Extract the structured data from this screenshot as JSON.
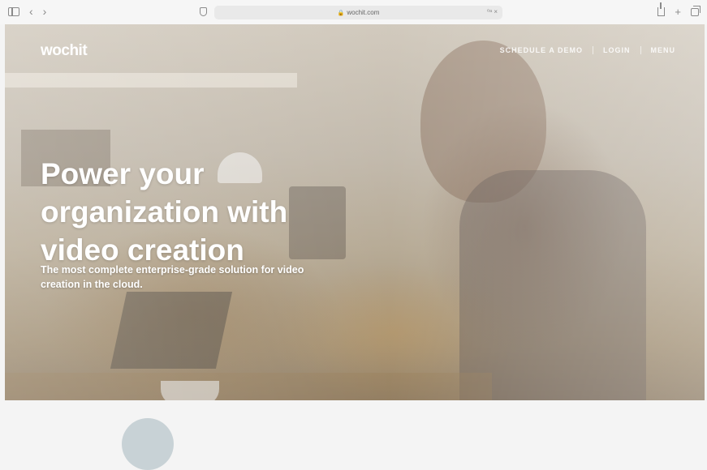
{
  "browser": {
    "url": "wochit.com",
    "nav_back": "‹",
    "nav_forward": "›",
    "lock_glyph": "🔒",
    "url_extra": "⁰ᵃ ×",
    "add_tab": "+"
  },
  "site": {
    "logo": "wochit",
    "nav": {
      "schedule_demo": "SCHEDULE A DEMO",
      "login": "LOGIN",
      "menu": "MENU"
    }
  },
  "hero": {
    "headline": "Power your organization with video creation",
    "subline": "The most complete enterprise-grade solution for video creation in the cloud."
  },
  "icons": {
    "sidebar": "sidebar-icon",
    "back": "chevron-left-icon",
    "forward": "chevron-right-icon",
    "privacy": "shield-icon",
    "share": "share-icon",
    "new_tab": "plus-icon",
    "tabs": "tabs-overview-icon"
  },
  "colors": {
    "chrome_bg": "#f6f6f6",
    "url_bg": "#e9e9e9",
    "hero_text": "#ffffff",
    "lower_bg": "#f4f4f4"
  }
}
